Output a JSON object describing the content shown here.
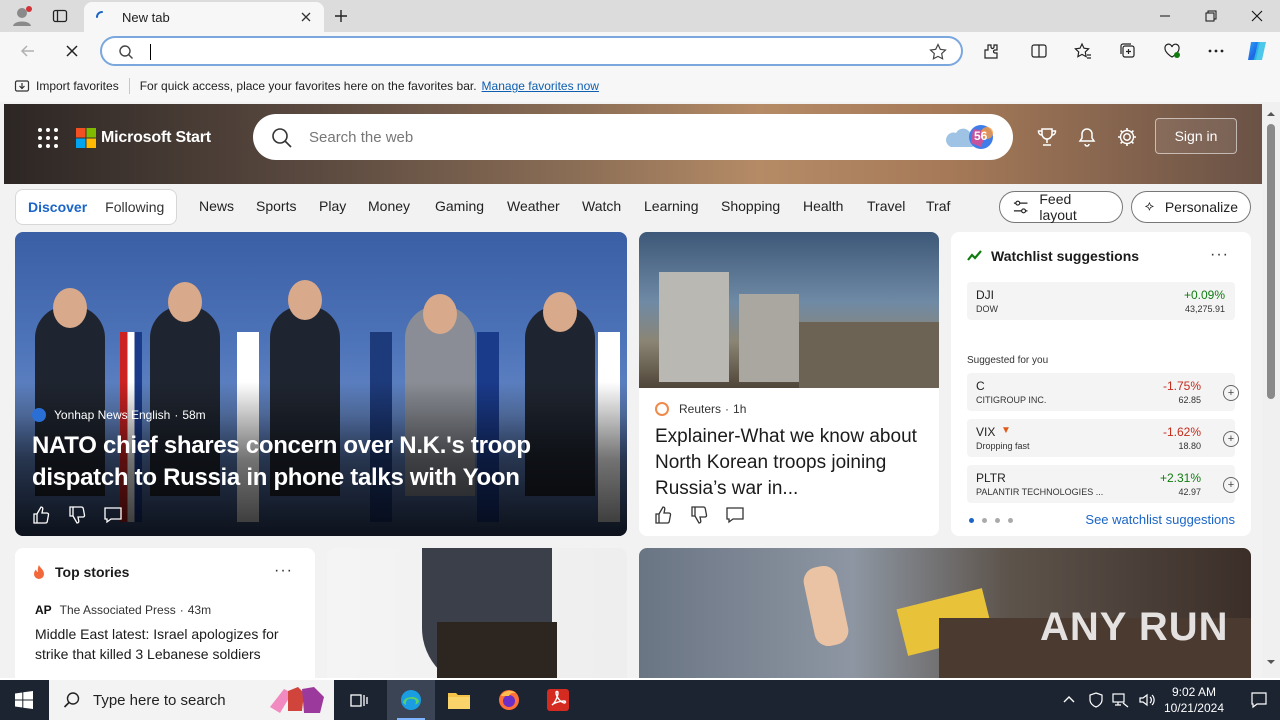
{
  "browser": {
    "tab_title": "New tab",
    "address_value": "",
    "favbar_import": "Import favorites",
    "favbar_message": "For quick access, place your favorites here on the favorites bar.",
    "favbar_manage": "Manage favorites now"
  },
  "msstart": {
    "brand": "Microsoft Start",
    "search_placeholder": "Search the web",
    "weather_badge": "56",
    "signin": "Sign in"
  },
  "nav": {
    "discover": "Discover",
    "following": "Following",
    "items": [
      "News",
      "Sports",
      "Play",
      "Money",
      "Gaming",
      "Weather",
      "Watch",
      "Learning",
      "Shopping",
      "Health",
      "Travel",
      "Traf"
    ],
    "feed_layout": "Feed layout",
    "personalize": "Personalize"
  },
  "hero": {
    "source": "Yonhap News English",
    "age": "58m",
    "title": "NATO chief shares concern over N.K.'s troop dispatch to Russia in phone talks with Yoon"
  },
  "card2": {
    "source": "Reuters",
    "age": "1h",
    "title": "Explainer-What we know about North Korean troops joining Russia’s war in..."
  },
  "watchlist": {
    "title": "Watchlist suggestions",
    "more": "···",
    "main": {
      "symbol": "DJI",
      "name": "DOW",
      "change": "+0.09%",
      "price": "43,275.91"
    },
    "suggested_label": "Suggested for you",
    "suggested": [
      {
        "symbol": "C",
        "name": "CITIGROUP INC.",
        "change": "-1.75%",
        "price": "62.85",
        "dir": "down"
      },
      {
        "symbol": "VIX",
        "name": "Dropping fast",
        "change": "-1.62%",
        "price": "18.80",
        "dir": "down"
      },
      {
        "symbol": "PLTR",
        "name": "PALANTIR TECHNOLOGIES ...",
        "change": "+2.31%",
        "price": "42.97",
        "dir": "up"
      }
    ],
    "see_all": "See watchlist suggestions"
  },
  "top_stories": {
    "title": "Top stories",
    "more": "···",
    "source_logo": "AP",
    "source": "The Associated Press",
    "age": "43m",
    "headline": "Middle East latest: Israel apologizes for strike that killed 3 Lebanese soldiers"
  },
  "watermark": "ANY RUN",
  "taskbar": {
    "search_placeholder": "Type here to search",
    "time": "9:02 AM",
    "date": "10/21/2024"
  },
  "colors": {
    "accent": "#1a65c7",
    "up": "#107c10",
    "down": "#c42b1c",
    "taskbar": "#1c2431"
  }
}
